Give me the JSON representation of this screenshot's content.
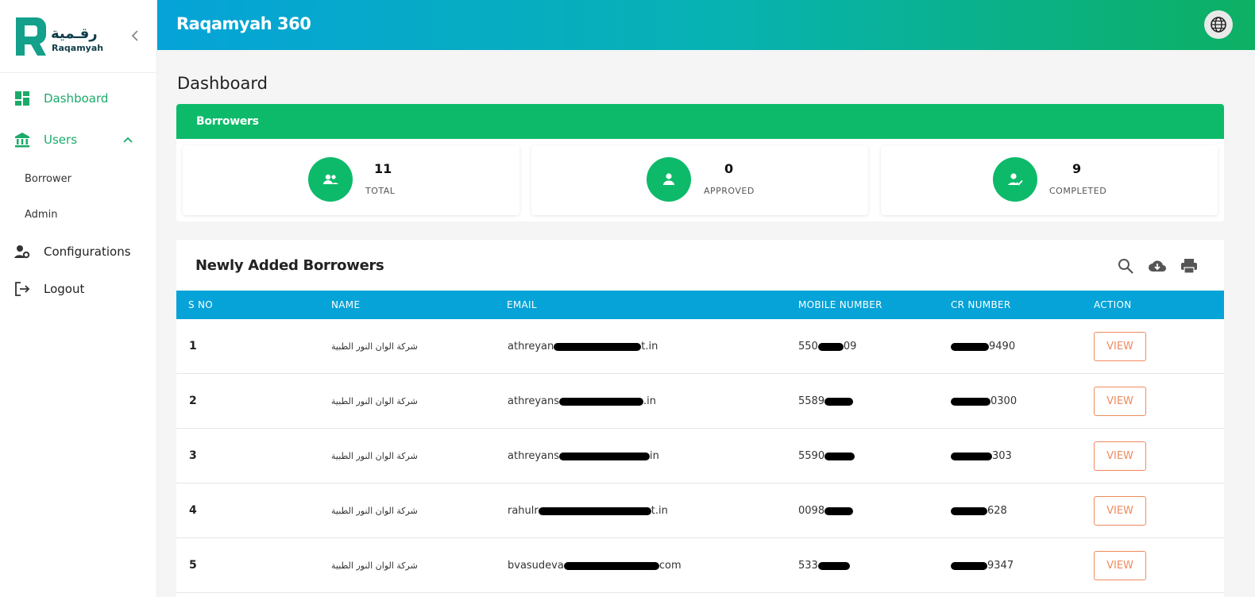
{
  "sidebar": {
    "logo_arabic": "رقـمية",
    "logo_english": "Raqamyah",
    "items": [
      {
        "label": "Dashboard",
        "icon": "dashboard-icon"
      },
      {
        "label": "Users",
        "icon": "bank-icon"
      },
      {
        "label": "Borrower"
      },
      {
        "label": "Admin"
      },
      {
        "label": "Configurations",
        "icon": "user-settings-icon"
      },
      {
        "label": "Logout",
        "icon": "logout-icon"
      }
    ]
  },
  "header": {
    "title": "Raqamyah 360",
    "language_icon": "globe-icon"
  },
  "page": {
    "title": "Dashboard"
  },
  "borrowers": {
    "title": "Borrowers",
    "stats": [
      {
        "value": "11",
        "label": "TOTAL",
        "icon": "group-icon"
      },
      {
        "value": "0",
        "label": "APPROVED",
        "icon": "person-icon"
      },
      {
        "value": "9",
        "label": "COMPLETED",
        "icon": "user-check-icon"
      }
    ]
  },
  "table": {
    "title": "Newly Added Borrowers",
    "tools": [
      "search-icon",
      "cloud-download-icon",
      "print-icon"
    ],
    "columns": [
      "S NO",
      "NAME",
      "EMAIL",
      "MOBILE NUMBER",
      "CR NUMBER",
      "ACTION"
    ],
    "rows": [
      {
        "sno": "1",
        "name": "شركة الوان النور الطبية",
        "email_pre": "athreyan",
        "email_post": "t.in",
        "mobile_pre": "550",
        "mobile_post": "09",
        "cr_pre": "",
        "cr_post": "9490",
        "action": "VIEW"
      },
      {
        "sno": "2",
        "name": "شركة الوان النور الطبية",
        "email_pre": "athreyans",
        "email_post": ".in",
        "mobile_pre": "5589",
        "mobile_post": "",
        "cr_pre": "",
        "cr_post": "0300",
        "action": "VIEW"
      },
      {
        "sno": "3",
        "name": "شركة الوان النور الطبية",
        "email_pre": "athreyans",
        "email_post": "in",
        "mobile_pre": "5590",
        "mobile_post": "",
        "cr_pre": "",
        "cr_post": "303",
        "action": "VIEW"
      },
      {
        "sno": "4",
        "name": "شركة الوان النور الطبية",
        "email_pre": "rahulr",
        "email_post": "t.in",
        "mobile_pre": "0098",
        "mobile_post": "",
        "cr_pre": "",
        "cr_post": "628",
        "action": "VIEW"
      },
      {
        "sno": "5",
        "name": "شركة الوان النور الطبية",
        "email_pre": "bvasudeva",
        "email_post": "com",
        "mobile_pre": "533",
        "mobile_post": "",
        "cr_pre": "",
        "cr_post": "9347",
        "action": "VIEW"
      }
    ]
  },
  "colors": {
    "brand_green": "#0dba6a",
    "header_blue": "#05a3d8",
    "action_orange": "#f08a5d",
    "nav_active": "#1aaa6a"
  }
}
